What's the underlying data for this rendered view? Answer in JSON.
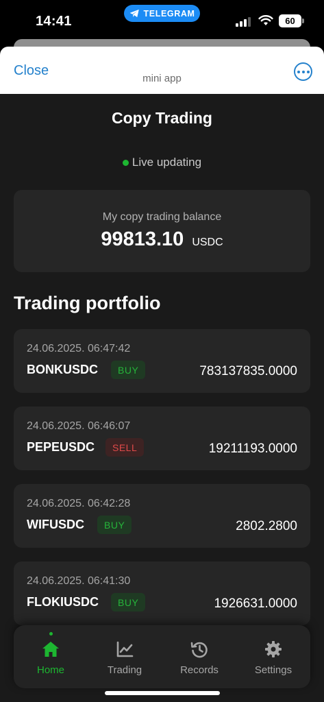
{
  "status_bar": {
    "time": "14:41",
    "telegram_label": "TELEGRAM",
    "battery": "60"
  },
  "sheet": {
    "close_label": "Close",
    "subtitle": "mini app"
  },
  "page": {
    "title": "Copy Trading",
    "live_text": "Live updating"
  },
  "balance": {
    "label": "My copy trading balance",
    "value": "99813.10",
    "unit": "USDC"
  },
  "portfolio": {
    "title": "Trading portfolio",
    "trades": [
      {
        "time": "24.06.2025. 06:47:42",
        "pair": "BONKUSDC",
        "side": "BUY",
        "amount": "783137835.0000"
      },
      {
        "time": "24.06.2025. 06:46:07",
        "pair": "PEPEUSDC",
        "side": "SELL",
        "amount": "19211193.0000"
      },
      {
        "time": "24.06.2025. 06:42:28",
        "pair": "WIFUSDC",
        "side": "BUY",
        "amount": "2802.2800"
      },
      {
        "time": "24.06.2025. 06:41:30",
        "pair": "FLOKIUSDC",
        "side": "BUY",
        "amount": "1926631.0000"
      }
    ]
  },
  "nav": {
    "items": [
      {
        "label": "Home",
        "icon": "home-icon",
        "active": true
      },
      {
        "label": "Trading",
        "icon": "chart-line-icon",
        "active": false
      },
      {
        "label": "Records",
        "icon": "history-icon",
        "active": false
      },
      {
        "label": "Settings",
        "icon": "gear-icon",
        "active": false
      }
    ]
  },
  "colors": {
    "accent_green": "#1db631",
    "telegram_blue": "#2481cc",
    "sell_red": "#e04a4a",
    "background": "#1a1a1a",
    "card": "#262626"
  }
}
